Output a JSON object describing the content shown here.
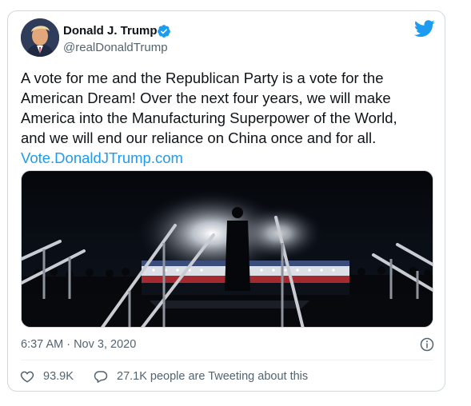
{
  "author": {
    "display_name": "Donald J. Trump",
    "handle": "@realDonaldTrump",
    "verified": true
  },
  "tweet": {
    "text_lines": [
      "A vote for me and the Republican Party is a vote for the",
      "American Dream! Over the next four years, we will make",
      "America into the Manufacturing Superpower of the World,",
      "and we will end our reliance on China once and for all."
    ],
    "link": "Vote.DonaldJTrump.com"
  },
  "meta": {
    "timestamp": "6:37 AM · Nov 3, 2020"
  },
  "actions": {
    "likes": "93.9K",
    "conversation": "27.1K people are Tweeting about this"
  },
  "icons": {
    "brand": "twitter-bird-icon",
    "verified": "verified-badge-icon",
    "info": "info-icon",
    "like": "heart-icon",
    "reply": "speech-bubble-icon"
  },
  "colors": {
    "brand": "#1d9bf0",
    "text": "#0f1419",
    "secondary": "#536471",
    "border": "#cfd9de"
  }
}
